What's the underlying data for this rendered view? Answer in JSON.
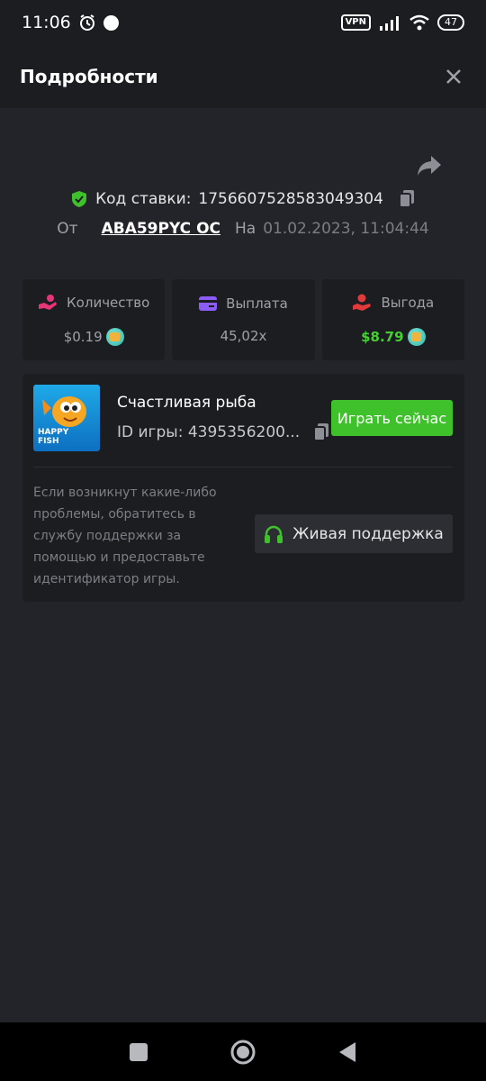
{
  "status_bar": {
    "time": "11:06",
    "vpn_label": "VPN",
    "battery": "47"
  },
  "header": {
    "title": "Подробности"
  },
  "bet": {
    "code_label": "Код ставки:",
    "code_value": "1756607528583049304",
    "from_label": "От",
    "username": "ABA59PYC OC",
    "on_label": "На",
    "datetime": "01.02.2023, 11:04:44"
  },
  "stats": [
    {
      "label": "Количество",
      "value": "$0.19",
      "icon": "hand-coins-icon",
      "color": "#e8357a"
    },
    {
      "label": "Выплата",
      "value": "45,02x",
      "icon": "card-icon",
      "color": "#8b5cf6"
    },
    {
      "label": "Выгода",
      "value": "$8.79",
      "icon": "hand-money-icon",
      "color": "#e03a3a"
    }
  ],
  "game": {
    "name": "Счастливая рыба",
    "id_label": "ID игры: 4395356200...",
    "play_label": "Играть сейчас",
    "thumb_text_1": "HAPPY",
    "thumb_text_2": "FISH",
    "help_text": "Если возникнут какие-либо проблемы, обратитесь в службу поддержки за помощью и предоставьте идентификатор игры.",
    "support_label": "Живая поддержка"
  },
  "colors": {
    "accent_green": "#3ec12a",
    "background": "#232429",
    "card": "#1c1d21"
  }
}
